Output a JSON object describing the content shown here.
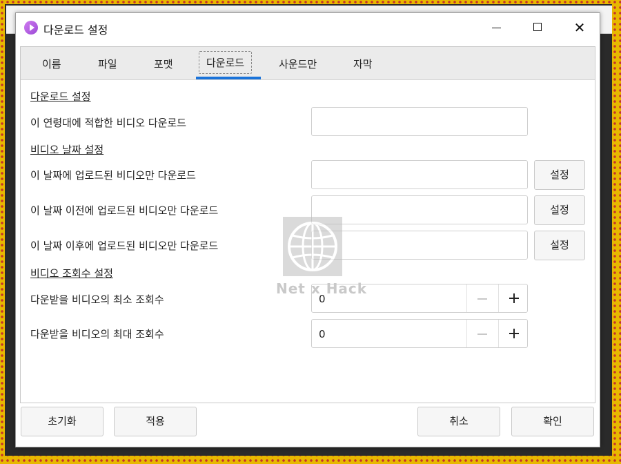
{
  "background_window": {
    "title_fragment": ""
  },
  "dialog": {
    "title": "다운로드 설정",
    "controls": {
      "minimize": "minimize-icon",
      "maximize": "maximize-icon",
      "close": "close-icon"
    }
  },
  "tabs": [
    {
      "label": "이름",
      "active": false
    },
    {
      "label": "파일",
      "active": false
    },
    {
      "label": "포맷",
      "active": false
    },
    {
      "label": "다운로드",
      "active": true
    },
    {
      "label": "사운드만",
      "active": false
    },
    {
      "label": "자막",
      "active": false
    }
  ],
  "sections": {
    "download": {
      "title": "다운로드 설정",
      "age_label": "이 연령대에 적합한 비디오 다운로드",
      "age_value": ""
    },
    "date": {
      "title": "비디오 날짜 설정",
      "rows": [
        {
          "label": "이 날짜에 업로드된 비디오만 다운로드",
          "value": "",
          "button": "설정"
        },
        {
          "label": "이 날짜 이전에 업로드된 비디오만 다운로드",
          "value": "",
          "button": "설정"
        },
        {
          "label": "이 날짜 이후에 업로드된 비디오만 다운로드",
          "value": "",
          "button": "설정"
        }
      ]
    },
    "views": {
      "title": "비디오 조회수 설정",
      "min_label": "다운받을 비디오의 최소 조회수",
      "min_value": "0",
      "max_label": "다운받을 비디오의 최대 조회수",
      "max_value": "0"
    }
  },
  "watermark": {
    "text": "Net x Hack",
    "icon": "globe-icon"
  },
  "footer": {
    "reset": "초기화",
    "apply": "적용",
    "cancel": "취소",
    "ok": "확인"
  },
  "colors": {
    "accent": "#1a73d9",
    "app_icon": "#b05ee6"
  }
}
